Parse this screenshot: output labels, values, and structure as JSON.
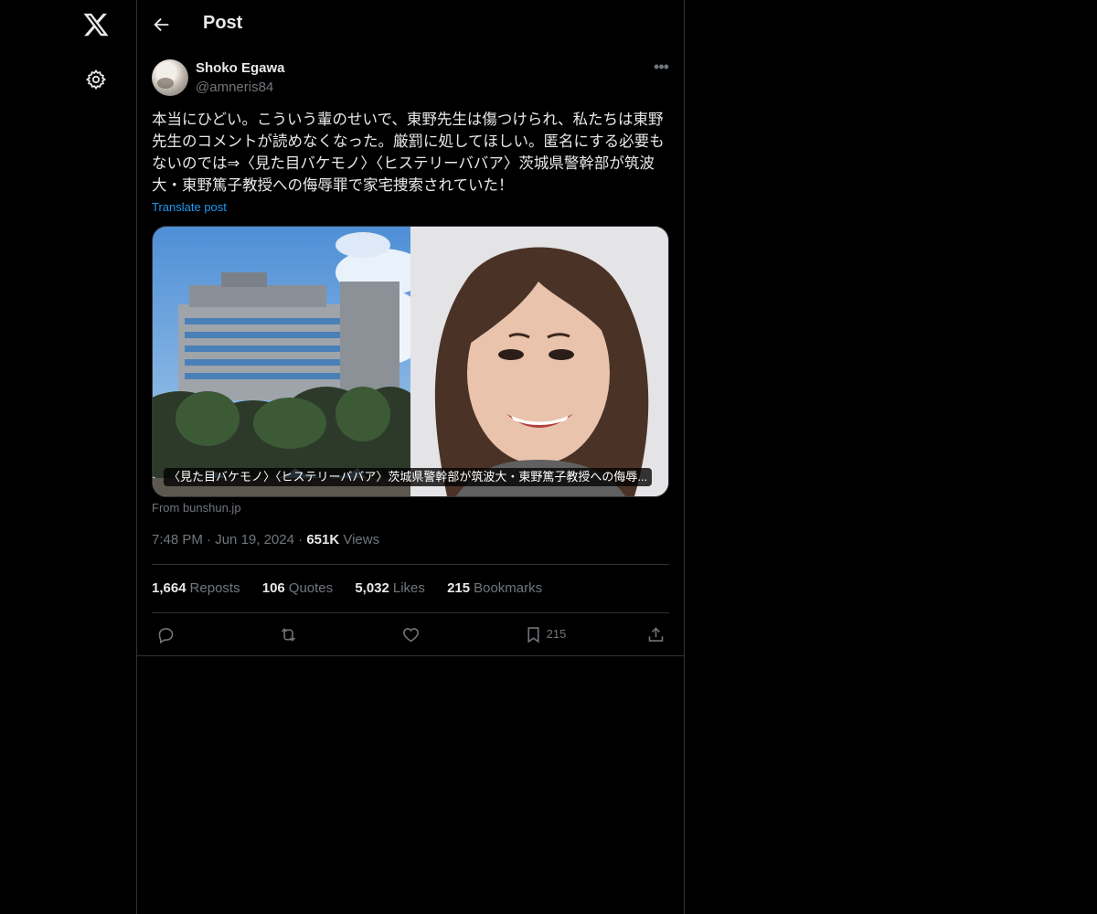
{
  "nav": {
    "logo_icon": "x-logo-icon",
    "settings_icon": "gear-icon"
  },
  "header": {
    "title": "Post",
    "back_icon": "arrow-left-icon"
  },
  "post": {
    "author": {
      "display_name": "Shoko Egawa",
      "handle": "@amneris84"
    },
    "text": "本当にひどい。こういう輩のせいで、東野先生は傷つけられ、私たちは東野先生のコメントが読めなくなった。厳罰に処してほしい。匿名にする必要もないのでは⇒〈見た目バケモノ〉〈ヒステリーババア〉茨城県警幹部が筑波大・東野篤子教授への侮辱罪で家宅捜索されていた！",
    "translate_label": "Translate post",
    "card": {
      "caption": "〈見た目バケモノ〉〈ヒステリーババア〉茨城県警幹部が筑波大・東野篤子教授への侮辱...",
      "source": "From bunshun.jp"
    },
    "time": "7:48 PM",
    "date": "Jun 19, 2024",
    "views_count": "651K",
    "views_label": "Views",
    "stats": [
      {
        "count": "1,664",
        "label": "Reposts"
      },
      {
        "count": "106",
        "label": "Quotes"
      },
      {
        "count": "5,032",
        "label": "Likes"
      },
      {
        "count": "215",
        "label": "Bookmarks"
      }
    ],
    "actions": {
      "reply_icon": "reply-icon",
      "repost_icon": "repost-icon",
      "like_icon": "heart-icon",
      "bookmark_icon": "bookmark-icon",
      "bookmark_count": "215",
      "share_icon": "share-icon"
    }
  },
  "colors": {
    "background": "#000000",
    "text": "#e7e9ea",
    "secondary": "#71767b",
    "accent": "#1d9bf0",
    "border": "#2f3336"
  }
}
